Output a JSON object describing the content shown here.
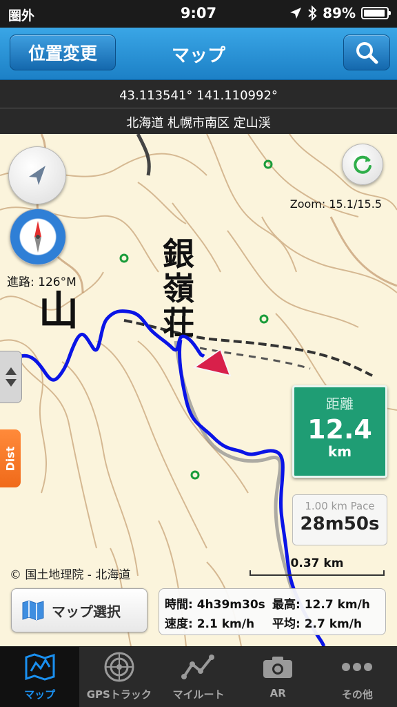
{
  "status_bar": {
    "carrier": "圏外",
    "time": "9:07",
    "battery": "89%",
    "battery_level": 0.89
  },
  "nav": {
    "left_button": "位置変更",
    "title": "マップ",
    "search_icon": "search-icon"
  },
  "info": {
    "coordinates": "43.113541° 141.110992°",
    "address": "北海道 札幌市南区 定山渓"
  },
  "map": {
    "zoom": "Zoom: 15.1/15.5",
    "course": "進路: 126°M",
    "dist_tab": "Dist",
    "distance": {
      "title": "距離",
      "value": "12.4",
      "unit": "km"
    },
    "pace": {
      "label": "1.00 km Pace",
      "value": "28m50s"
    },
    "scale": "0.37 km",
    "copyright": "© 国土地理院 - 北海道",
    "labels": {
      "kanji_mountain": "山",
      "kanji_place": [
        "銀",
        "嶺",
        "荘"
      ]
    },
    "map_select": "マップ選択",
    "stats": {
      "time": "時間: 4h39m30s",
      "max": "最高: 12.7 km/h",
      "speed": "速度: 2.1 km/h",
      "avg": "平均: 2.7 km/h"
    },
    "track_color": "#0a14e6"
  },
  "tabs": [
    {
      "label": "マップ",
      "icon": "map-icon",
      "active": true
    },
    {
      "label": "GPSトラック",
      "icon": "radar-icon",
      "active": false
    },
    {
      "label": "マイルート",
      "icon": "route-icon",
      "active": false
    },
    {
      "label": "AR",
      "icon": "camera-icon",
      "active": false
    },
    {
      "label": "その他",
      "icon": "more-icon",
      "active": false
    }
  ]
}
